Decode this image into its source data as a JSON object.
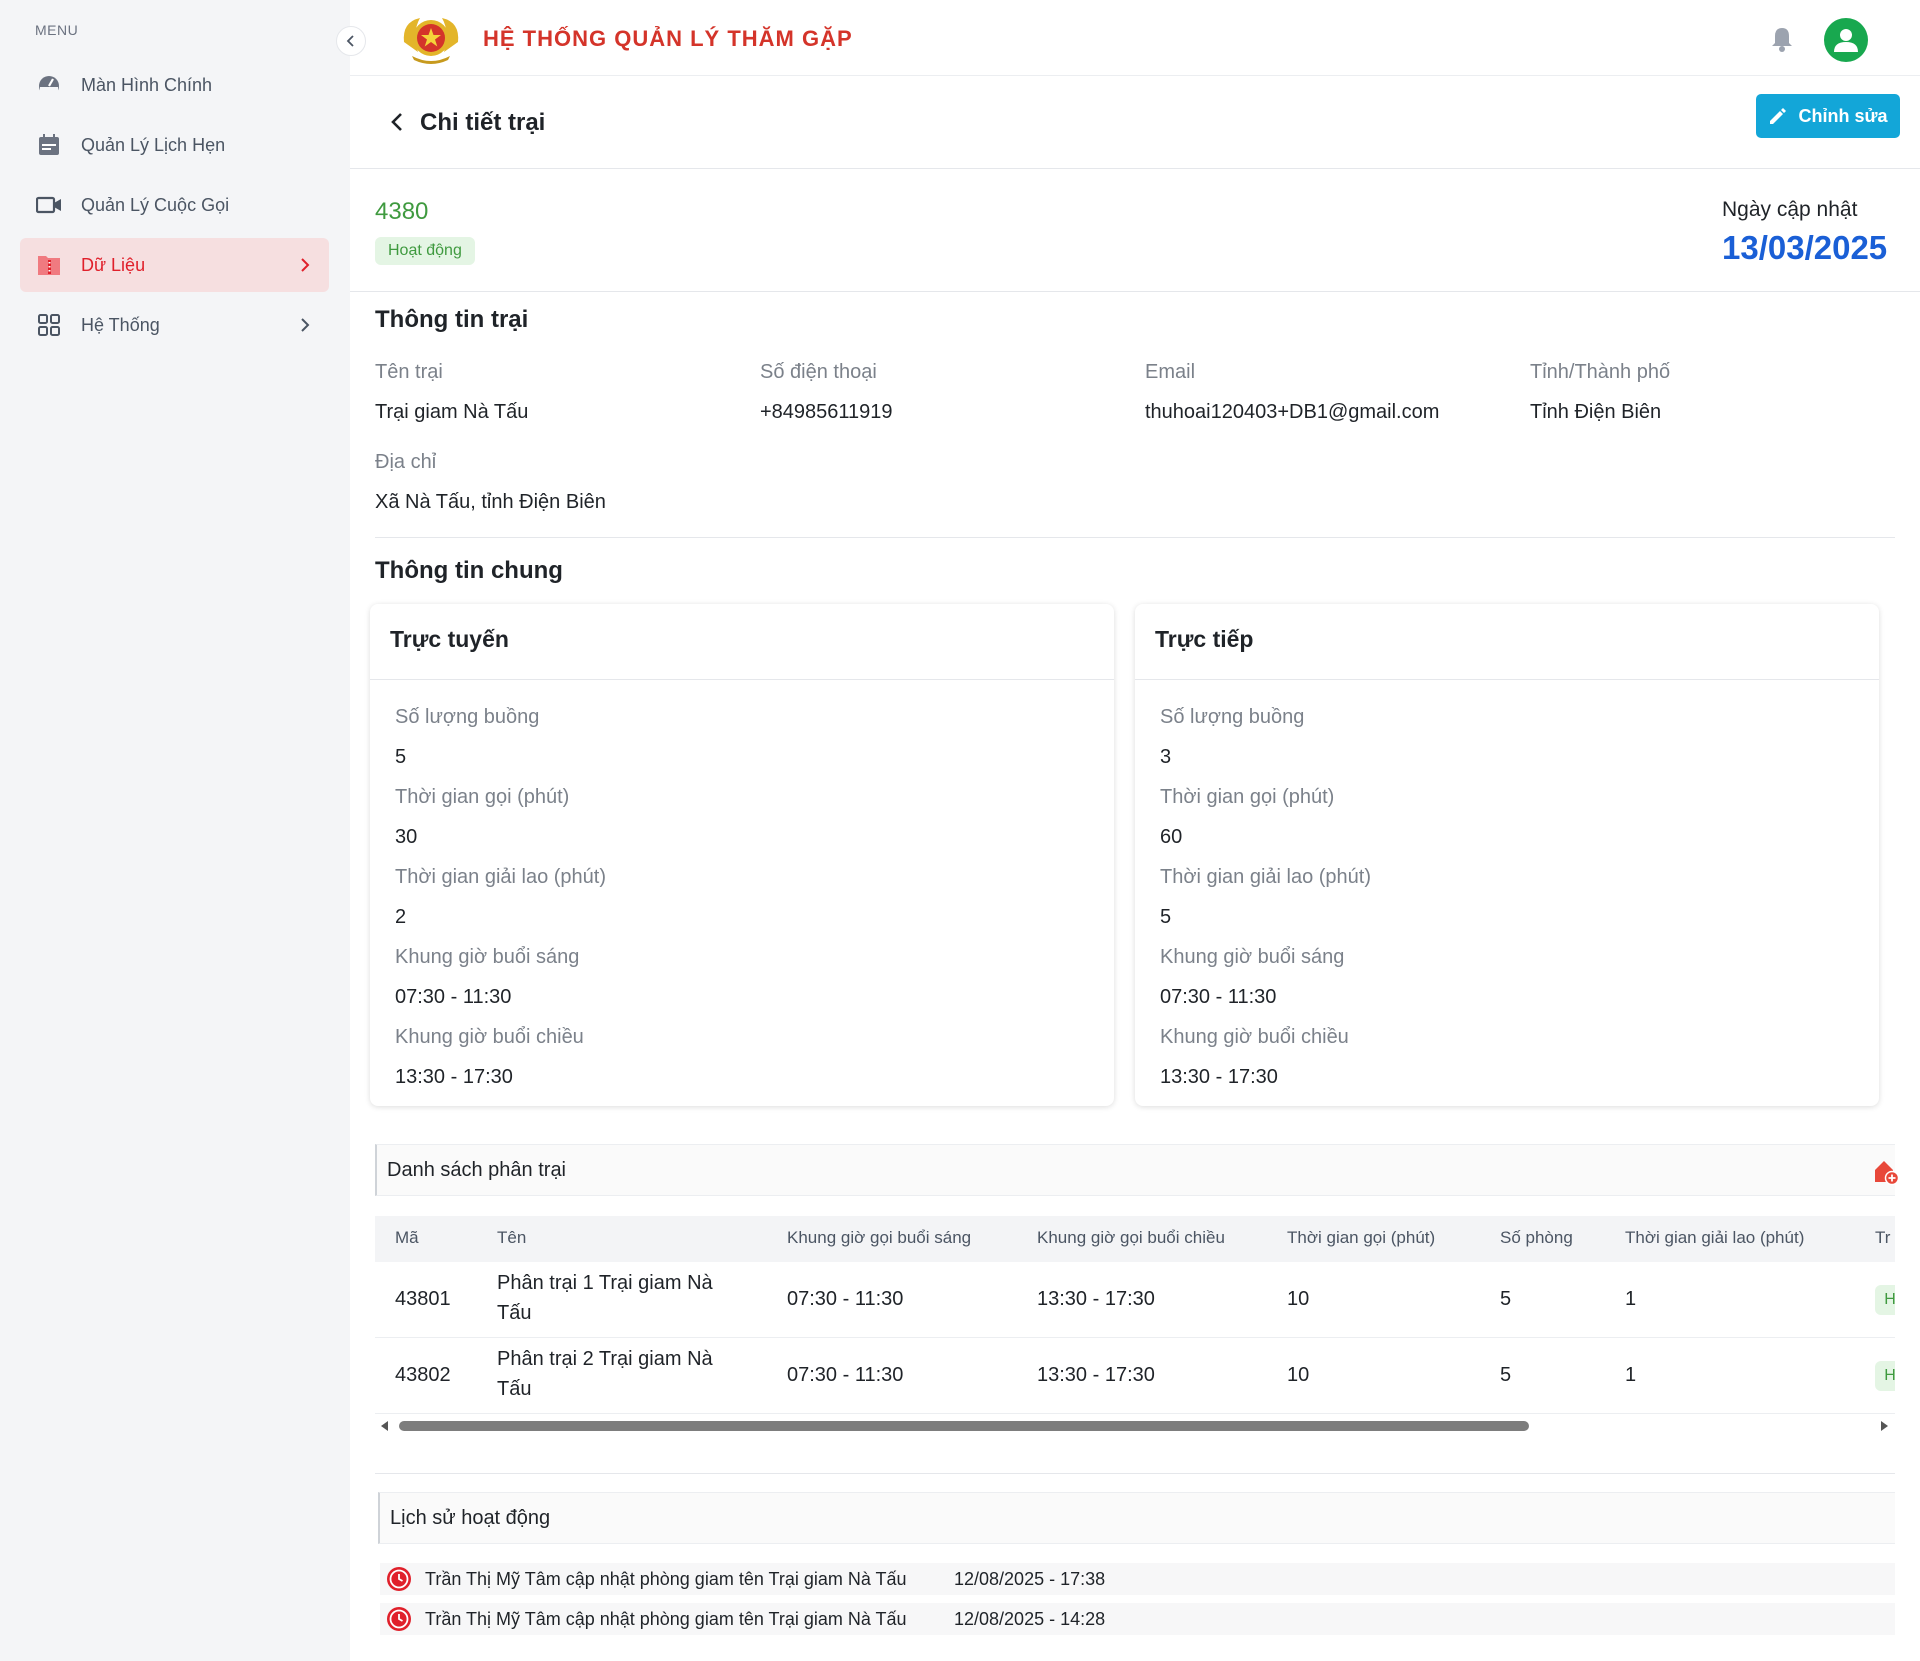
{
  "sidebar": {
    "menu_title": "MENU",
    "items": [
      {
        "label": "Màn Hình Chính",
        "icon": "dashboard-icon"
      },
      {
        "label": "Quản Lý Lịch Hẹn",
        "icon": "calendar-icon"
      },
      {
        "label": "Quản Lý Cuộc Gọi",
        "icon": "video-icon"
      },
      {
        "label": "Dữ Liệu",
        "icon": "folder-icon",
        "active": true,
        "has_chevron": true
      },
      {
        "label": "Hệ Thống",
        "icon": "grid-icon",
        "has_chevron": true
      }
    ]
  },
  "header": {
    "title": "HỆ THỐNG QUẢN LÝ THĂM GẶP"
  },
  "page": {
    "title": "Chi tiết trại",
    "edit_label": "Chỉnh sửa",
    "code": "4380",
    "status": "Hoạt động",
    "updated_label": "Ngày cập nhật",
    "updated_date": "13/03/2025"
  },
  "camp_info": {
    "section_title": "Thông tin trại",
    "name_label": "Tên trại",
    "name": "Trại giam Nà Tấu",
    "phone_label": "Số điện thoại",
    "phone": "+84985611919",
    "email_label": "Email",
    "email": "thuhoai120403+DB1@gmail.com",
    "city_label": "Tỉnh/Thành phố",
    "city": "Tỉnh Điện Biên",
    "address_label": "Địa chỉ",
    "address": "Xã Nà Tấu, tỉnh Điện Biên"
  },
  "general": {
    "section_title": "Thông tin chung",
    "online": {
      "title": "Trực tuyến",
      "rooms_label": "Số lượng buồng",
      "rooms": "5",
      "call_label": "Thời gian gọi (phút)",
      "call": "30",
      "break_label": "Thời gian giải lao (phút)",
      "break": "2",
      "morning_label": "Khung giờ buổi sáng",
      "morning": "07:30 - 11:30",
      "afternoon_label": "Khung giờ buổi chiều",
      "afternoon": "13:30 - 17:30"
    },
    "direct": {
      "title": "Trực tiếp",
      "rooms_label": "Số lượng buồng",
      "rooms": "3",
      "call_label": "Thời gian gọi (phút)",
      "call": "60",
      "break_label": "Thời gian giải lao (phút)",
      "break": "5",
      "morning_label": "Khung giờ buổi sáng",
      "morning": "07:30 - 11:30",
      "afternoon_label": "Khung giờ buổi chiều",
      "afternoon": "13:30 - 17:30"
    }
  },
  "subcamps": {
    "title": "Danh sách phân trại",
    "headers": [
      "Mã",
      "Tên",
      "Khung giờ gọi buổi sáng",
      "Khung giờ gọi buổi chiều",
      "Thời gian gọi (phút)",
      "Số phòng",
      "Thời gian giải lao (phút)",
      "Tr"
    ],
    "rows": [
      {
        "code": "43801",
        "name_l1": "Phân trại 1 Trại giam Nà",
        "name_l2": "Tấu",
        "morning": "07:30 - 11:30",
        "afternoon": "13:30 - 17:30",
        "call": "10",
        "rooms": "5",
        "break": "1",
        "status": "H"
      },
      {
        "code": "43802",
        "name_l1": "Phân trại 2 Trại giam Nà",
        "name_l2": "Tấu",
        "morning": "07:30 - 11:30",
        "afternoon": "13:30 - 17:30",
        "call": "10",
        "rooms": "5",
        "break": "1",
        "status": "H"
      }
    ]
  },
  "history": {
    "title": "Lịch sử hoạt động",
    "items": [
      {
        "text": "Trần Thị Mỹ Tâm cập nhật phòng giam tên Trại giam Nà Tấu",
        "time": "12/08/2025 - 17:38"
      },
      {
        "text": "Trần Thị Mỹ Tâm cập nhật phòng giam tên Trại giam Nà Tấu",
        "time": "12/08/2025 - 14:28"
      }
    ]
  },
  "colors": {
    "brand_red": "#d4342a",
    "accent_blue": "#13a6d8",
    "status_green": "#3f9a3f",
    "date_blue": "#1a5fd6"
  }
}
